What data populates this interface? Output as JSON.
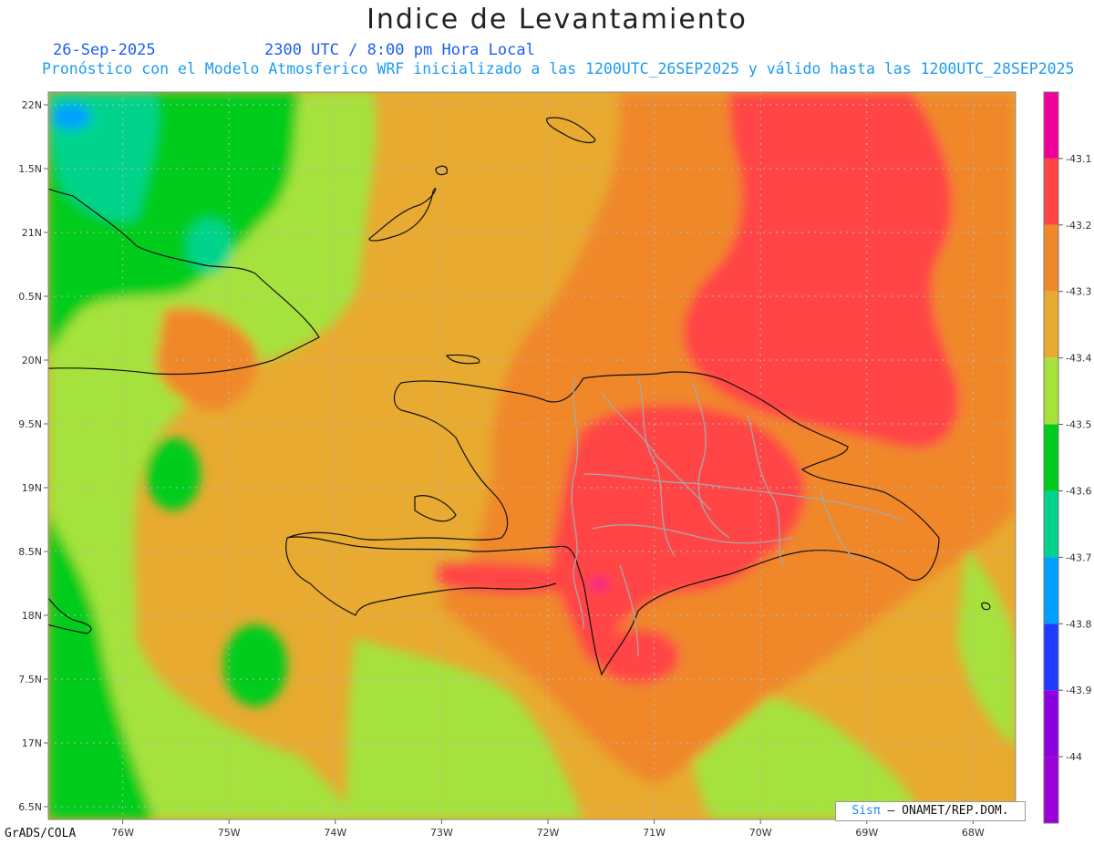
{
  "title": "Indice de Levantamiento",
  "date": "26-Sep-2025",
  "time": "2300 UTC / 8:00 pm Hora Local",
  "model_line": "Pronóstico con el Modelo Atmosferico WRF inicializado a las 1200UTC_26SEP2025 y válido hasta las  1200UTC_28SEP2025",
  "footer": "GrADS/COLA",
  "credit": {
    "brand": "Sisπ",
    "rest": "– ONAMET/REP.DOM."
  },
  "map": {
    "lon_range": [
      -76.7,
      -67.6
    ],
    "lat_range": [
      16.4,
      22.1
    ],
    "lon_ticks": [
      {
        "v": -76,
        "label": "76W"
      },
      {
        "v": -75,
        "label": "75W"
      },
      {
        "v": -74,
        "label": "74W"
      },
      {
        "v": -73,
        "label": "73W"
      },
      {
        "v": -72,
        "label": "72W"
      },
      {
        "v": -71,
        "label": "71W"
      },
      {
        "v": -70,
        "label": "70W"
      },
      {
        "v": -69,
        "label": "69W"
      },
      {
        "v": -68,
        "label": "68W"
      }
    ],
    "lat_ticks": [
      {
        "v": 22,
        "label": "22N"
      },
      {
        "v": 21.5,
        "label": "1.5N"
      },
      {
        "v": 21,
        "label": "21N"
      },
      {
        "v": 20.5,
        "label": "0.5N"
      },
      {
        "v": 20,
        "label": "20N"
      },
      {
        "v": 19.5,
        "label": "9.5N"
      },
      {
        "v": 19,
        "label": "19N"
      },
      {
        "v": 18.5,
        "label": "8.5N"
      },
      {
        "v": 18,
        "label": "18N"
      },
      {
        "v": 17.5,
        "label": "7.5N"
      },
      {
        "v": 17,
        "label": "17N"
      },
      {
        "v": 16.5,
        "label": "6.5N"
      }
    ]
  },
  "legend": {
    "colors": [
      "#f0009a",
      "#ff4444",
      "#f0882a",
      "#e8aa30",
      "#a6e23c",
      "#00cc1e",
      "#00d48c",
      "#00a0ff",
      "#1e3cff",
      "#8c00e0",
      "#9a00d8"
    ],
    "labels": [
      "-43.1",
      "-43.2",
      "-43.3",
      "-43.4",
      "-43.5",
      "-43.6",
      "-43.7",
      "-43.8",
      "-43.9",
      "-44"
    ]
  }
}
